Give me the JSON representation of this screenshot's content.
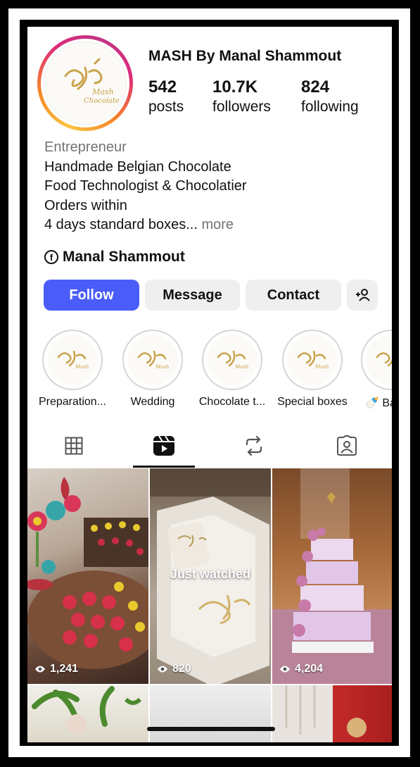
{
  "profile": {
    "name": "MASH By Manal Shammout",
    "stats": [
      {
        "num": "542",
        "label": "posts"
      },
      {
        "num": "10.7K",
        "label": "followers"
      },
      {
        "num": "824",
        "label": "following"
      }
    ],
    "category": "Entrepreneur",
    "bio_lines": [
      "Handmade Belgian Chocolate",
      "Food Technologist & Chocolatier",
      "Orders within"
    ],
    "bio_last": "4 days standard boxes...",
    "more": " more",
    "facebook_name": "Manal Shammout",
    "facebook_icon": "f"
  },
  "buttons": {
    "follow": "Follow",
    "message": "Message",
    "contact": "Contact",
    "add_icon": "+👤"
  },
  "highlights": [
    {
      "label": "Preparation..."
    },
    {
      "label": "Wedding"
    },
    {
      "label": "Chocolate t..."
    },
    {
      "label": "Special boxes"
    },
    {
      "label": "🍼 Ba"
    }
  ],
  "posts": [
    {
      "views": "1,241",
      "overlay": ""
    },
    {
      "views": "820",
      "overlay": "Just watched"
    },
    {
      "views": "4,204",
      "overlay": ""
    }
  ],
  "colors": {
    "follow": "#4a5df9",
    "gold": "#c9a24a"
  }
}
